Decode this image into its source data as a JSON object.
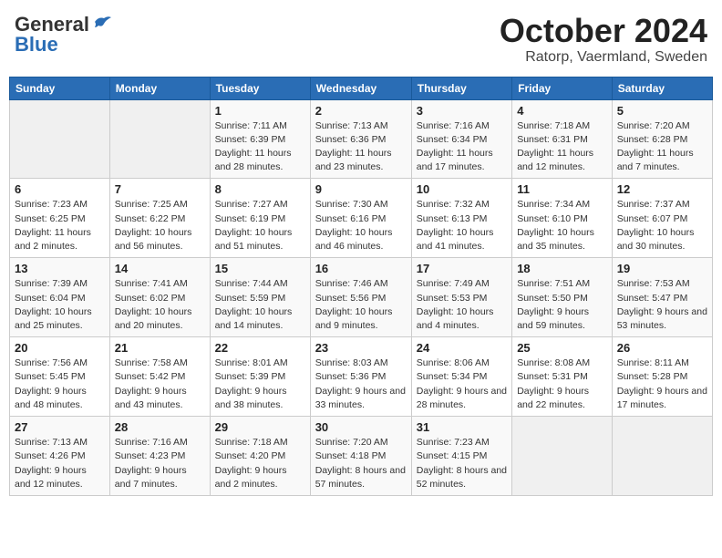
{
  "header": {
    "logo_general": "General",
    "logo_blue": "Blue",
    "title": "October 2024",
    "location": "Ratorp, Vaermland, Sweden"
  },
  "weekdays": [
    "Sunday",
    "Monday",
    "Tuesday",
    "Wednesday",
    "Thursday",
    "Friday",
    "Saturday"
  ],
  "weeks": [
    [
      {
        "day": "",
        "info": ""
      },
      {
        "day": "",
        "info": ""
      },
      {
        "day": "1",
        "info": "Sunrise: 7:11 AM\nSunset: 6:39 PM\nDaylight: 11 hours and 28 minutes."
      },
      {
        "day": "2",
        "info": "Sunrise: 7:13 AM\nSunset: 6:36 PM\nDaylight: 11 hours and 23 minutes."
      },
      {
        "day": "3",
        "info": "Sunrise: 7:16 AM\nSunset: 6:34 PM\nDaylight: 11 hours and 17 minutes."
      },
      {
        "day": "4",
        "info": "Sunrise: 7:18 AM\nSunset: 6:31 PM\nDaylight: 11 hours and 12 minutes."
      },
      {
        "day": "5",
        "info": "Sunrise: 7:20 AM\nSunset: 6:28 PM\nDaylight: 11 hours and 7 minutes."
      }
    ],
    [
      {
        "day": "6",
        "info": "Sunrise: 7:23 AM\nSunset: 6:25 PM\nDaylight: 11 hours and 2 minutes."
      },
      {
        "day": "7",
        "info": "Sunrise: 7:25 AM\nSunset: 6:22 PM\nDaylight: 10 hours and 56 minutes."
      },
      {
        "day": "8",
        "info": "Sunrise: 7:27 AM\nSunset: 6:19 PM\nDaylight: 10 hours and 51 minutes."
      },
      {
        "day": "9",
        "info": "Sunrise: 7:30 AM\nSunset: 6:16 PM\nDaylight: 10 hours and 46 minutes."
      },
      {
        "day": "10",
        "info": "Sunrise: 7:32 AM\nSunset: 6:13 PM\nDaylight: 10 hours and 41 minutes."
      },
      {
        "day": "11",
        "info": "Sunrise: 7:34 AM\nSunset: 6:10 PM\nDaylight: 10 hours and 35 minutes."
      },
      {
        "day": "12",
        "info": "Sunrise: 7:37 AM\nSunset: 6:07 PM\nDaylight: 10 hours and 30 minutes."
      }
    ],
    [
      {
        "day": "13",
        "info": "Sunrise: 7:39 AM\nSunset: 6:04 PM\nDaylight: 10 hours and 25 minutes."
      },
      {
        "day": "14",
        "info": "Sunrise: 7:41 AM\nSunset: 6:02 PM\nDaylight: 10 hours and 20 minutes."
      },
      {
        "day": "15",
        "info": "Sunrise: 7:44 AM\nSunset: 5:59 PM\nDaylight: 10 hours and 14 minutes."
      },
      {
        "day": "16",
        "info": "Sunrise: 7:46 AM\nSunset: 5:56 PM\nDaylight: 10 hours and 9 minutes."
      },
      {
        "day": "17",
        "info": "Sunrise: 7:49 AM\nSunset: 5:53 PM\nDaylight: 10 hours and 4 minutes."
      },
      {
        "day": "18",
        "info": "Sunrise: 7:51 AM\nSunset: 5:50 PM\nDaylight: 9 hours and 59 minutes."
      },
      {
        "day": "19",
        "info": "Sunrise: 7:53 AM\nSunset: 5:47 PM\nDaylight: 9 hours and 53 minutes."
      }
    ],
    [
      {
        "day": "20",
        "info": "Sunrise: 7:56 AM\nSunset: 5:45 PM\nDaylight: 9 hours and 48 minutes."
      },
      {
        "day": "21",
        "info": "Sunrise: 7:58 AM\nSunset: 5:42 PM\nDaylight: 9 hours and 43 minutes."
      },
      {
        "day": "22",
        "info": "Sunrise: 8:01 AM\nSunset: 5:39 PM\nDaylight: 9 hours and 38 minutes."
      },
      {
        "day": "23",
        "info": "Sunrise: 8:03 AM\nSunset: 5:36 PM\nDaylight: 9 hours and 33 minutes."
      },
      {
        "day": "24",
        "info": "Sunrise: 8:06 AM\nSunset: 5:34 PM\nDaylight: 9 hours and 28 minutes."
      },
      {
        "day": "25",
        "info": "Sunrise: 8:08 AM\nSunset: 5:31 PM\nDaylight: 9 hours and 22 minutes."
      },
      {
        "day": "26",
        "info": "Sunrise: 8:11 AM\nSunset: 5:28 PM\nDaylight: 9 hours and 17 minutes."
      }
    ],
    [
      {
        "day": "27",
        "info": "Sunrise: 7:13 AM\nSunset: 4:26 PM\nDaylight: 9 hours and 12 minutes."
      },
      {
        "day": "28",
        "info": "Sunrise: 7:16 AM\nSunset: 4:23 PM\nDaylight: 9 hours and 7 minutes."
      },
      {
        "day": "29",
        "info": "Sunrise: 7:18 AM\nSunset: 4:20 PM\nDaylight: 9 hours and 2 minutes."
      },
      {
        "day": "30",
        "info": "Sunrise: 7:20 AM\nSunset: 4:18 PM\nDaylight: 8 hours and 57 minutes."
      },
      {
        "day": "31",
        "info": "Sunrise: 7:23 AM\nSunset: 4:15 PM\nDaylight: 8 hours and 52 minutes."
      },
      {
        "day": "",
        "info": ""
      },
      {
        "day": "",
        "info": ""
      }
    ]
  ]
}
